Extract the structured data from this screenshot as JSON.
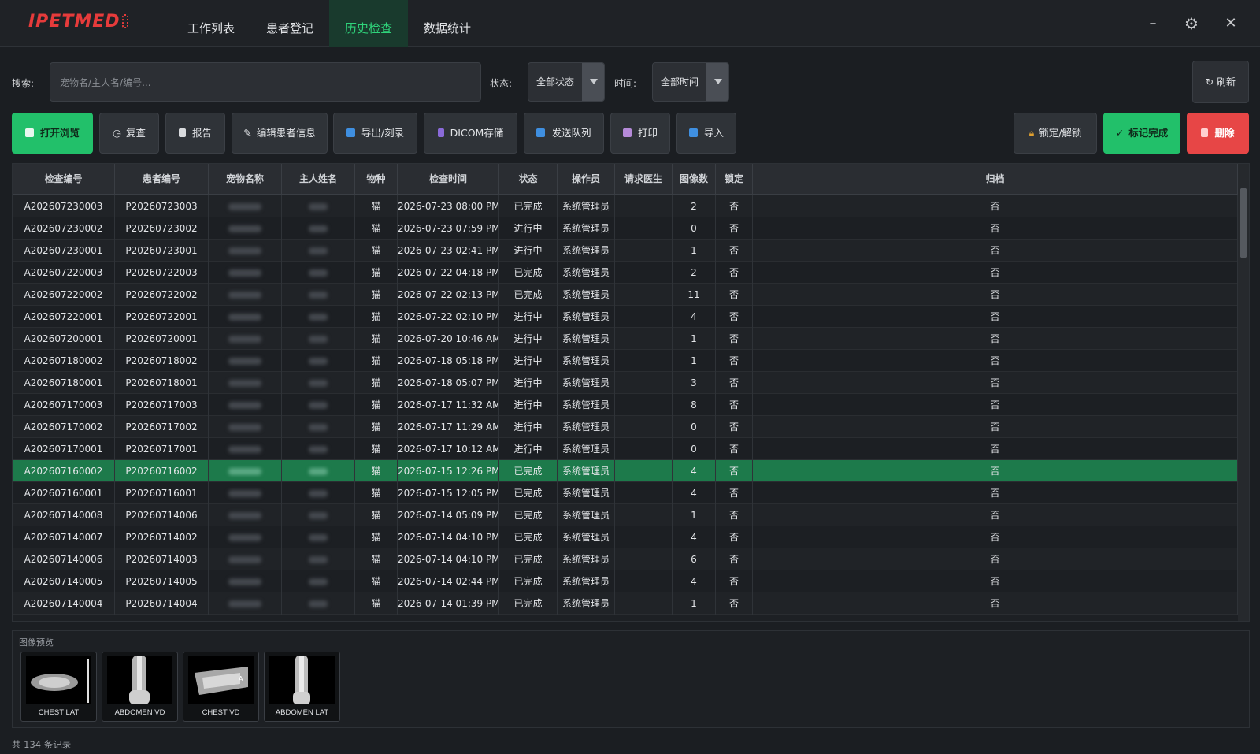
{
  "app": {
    "logo": "IPETMED"
  },
  "nav": [
    {
      "label": "工作列表",
      "active": false
    },
    {
      "label": "患者登记",
      "active": false
    },
    {
      "label": "历史检查",
      "active": true
    },
    {
      "label": "数据统计",
      "active": false
    }
  ],
  "window": {
    "minimize": "–",
    "settings": "⚙",
    "close": "✕"
  },
  "search": {
    "label": "搜索:",
    "placeholder": "宠物名/主人名/编号..."
  },
  "filters": {
    "status_label": "状态:",
    "status_value": "全部状态",
    "time_label": "时间:",
    "time_value": "全部时间"
  },
  "refresh_label": "刷新",
  "toolbar": {
    "open_view": "打开浏览",
    "recheck": "复查",
    "report": "报告",
    "edit_patient": "编辑患者信息",
    "export": "导出/刻录",
    "dicom": "DICOM存储",
    "send_queue": "发送队列",
    "print": "打印",
    "import": "导入",
    "lock": "锁定/解锁",
    "mark_done": "标记完成",
    "delete": "删除"
  },
  "colors": {
    "accent": "#22c06a",
    "danger": "#e74646",
    "selected_row": "#1d7a4b"
  },
  "table": {
    "columns": [
      "检查编号",
      "患者编号",
      "宠物名称",
      "主人姓名",
      "物种",
      "检查时间",
      "状态",
      "操作员",
      "请求医生",
      "图像数",
      "锁定",
      "归档"
    ],
    "rows": [
      {
        "exam": "A202607230003",
        "patient": "P20260723003",
        "species": "猫",
        "time": "2026-07-23 08:00 PM",
        "status": "已完成",
        "operator": "系统管理员",
        "doctor": "",
        "images": "2",
        "locked": "否",
        "archived": "否"
      },
      {
        "exam": "A202607230002",
        "patient": "P20260723002",
        "species": "猫",
        "time": "2026-07-23 07:59 PM",
        "status": "进行中",
        "operator": "系统管理员",
        "doctor": "",
        "images": "0",
        "locked": "否",
        "archived": "否"
      },
      {
        "exam": "A202607230001",
        "patient": "P20260723001",
        "species": "猫",
        "time": "2026-07-23 02:41 PM",
        "status": "进行中",
        "operator": "系统管理员",
        "doctor": "",
        "images": "1",
        "locked": "否",
        "archived": "否"
      },
      {
        "exam": "A202607220003",
        "patient": "P20260722003",
        "species": "猫",
        "time": "2026-07-22 04:18 PM",
        "status": "已完成",
        "operator": "系统管理员",
        "doctor": "",
        "images": "2",
        "locked": "否",
        "archived": "否"
      },
      {
        "exam": "A202607220002",
        "patient": "P20260722002",
        "species": "猫",
        "time": "2026-07-22 02:13 PM",
        "status": "已完成",
        "operator": "系统管理员",
        "doctor": "",
        "images": "11",
        "locked": "否",
        "archived": "否"
      },
      {
        "exam": "A202607220001",
        "patient": "P20260722001",
        "species": "猫",
        "time": "2026-07-22 02:10 PM",
        "status": "进行中",
        "operator": "系统管理员",
        "doctor": "",
        "images": "4",
        "locked": "否",
        "archived": "否"
      },
      {
        "exam": "A202607200001",
        "patient": "P20260720001",
        "species": "猫",
        "time": "2026-07-20 10:46 AM",
        "status": "进行中",
        "operator": "系统管理员",
        "doctor": "",
        "images": "1",
        "locked": "否",
        "archived": "否"
      },
      {
        "exam": "A202607180002",
        "patient": "P20260718002",
        "species": "猫",
        "time": "2026-07-18 05:18 PM",
        "status": "进行中",
        "operator": "系统管理员",
        "doctor": "",
        "images": "1",
        "locked": "否",
        "archived": "否"
      },
      {
        "exam": "A202607180001",
        "patient": "P20260718001",
        "species": "猫",
        "time": "2026-07-18 05:07 PM",
        "status": "进行中",
        "operator": "系统管理员",
        "doctor": "",
        "images": "3",
        "locked": "否",
        "archived": "否"
      },
      {
        "exam": "A202607170003",
        "patient": "P20260717003",
        "species": "猫",
        "time": "2026-07-17 11:32 AM",
        "status": "进行中",
        "operator": "系统管理员",
        "doctor": "",
        "images": "8",
        "locked": "否",
        "archived": "否"
      },
      {
        "exam": "A202607170002",
        "patient": "P20260717002",
        "species": "猫",
        "time": "2026-07-17 11:29 AM",
        "status": "进行中",
        "operator": "系统管理员",
        "doctor": "",
        "images": "0",
        "locked": "否",
        "archived": "否"
      },
      {
        "exam": "A202607170001",
        "patient": "P20260717001",
        "species": "猫",
        "time": "2026-07-17 10:12 AM",
        "status": "进行中",
        "operator": "系统管理员",
        "doctor": "",
        "images": "0",
        "locked": "否",
        "archived": "否"
      },
      {
        "exam": "A202607160002",
        "patient": "P20260716002",
        "species": "猫",
        "time": "2026-07-15 12:26 PM",
        "status": "已完成",
        "operator": "系统管理员",
        "doctor": "",
        "images": "4",
        "locked": "否",
        "archived": "否",
        "selected": true
      },
      {
        "exam": "A202607160001",
        "patient": "P20260716001",
        "species": "猫",
        "time": "2026-07-15 12:05 PM",
        "status": "已完成",
        "operator": "系统管理员",
        "doctor": "",
        "images": "4",
        "locked": "否",
        "archived": "否"
      },
      {
        "exam": "A202607140008",
        "patient": "P20260714006",
        "species": "猫",
        "time": "2026-07-14 05:09 PM",
        "status": "已完成",
        "operator": "系统管理员",
        "doctor": "",
        "images": "1",
        "locked": "否",
        "archived": "否"
      },
      {
        "exam": "A202607140007",
        "patient": "P20260714002",
        "species": "猫",
        "time": "2026-07-14 04:10 PM",
        "status": "已完成",
        "operator": "系统管理员",
        "doctor": "",
        "images": "4",
        "locked": "否",
        "archived": "否"
      },
      {
        "exam": "A202607140006",
        "patient": "P20260714003",
        "species": "猫",
        "time": "2026-07-14 04:10 PM",
        "status": "已完成",
        "operator": "系统管理员",
        "doctor": "",
        "images": "6",
        "locked": "否",
        "archived": "否"
      },
      {
        "exam": "A202607140005",
        "patient": "P20260714005",
        "species": "猫",
        "time": "2026-07-14 02:44 PM",
        "status": "已完成",
        "operator": "系统管理员",
        "doctor": "",
        "images": "4",
        "locked": "否",
        "archived": "否"
      },
      {
        "exam": "A202607140004",
        "patient": "P20260714004",
        "species": "猫",
        "time": "2026-07-14 01:39 PM",
        "status": "已完成",
        "operator": "系统管理员",
        "doctor": "",
        "images": "1",
        "locked": "否",
        "archived": "否"
      }
    ]
  },
  "preview": {
    "title": "图像预览",
    "images": [
      {
        "caption": "CHEST LAT"
      },
      {
        "caption": "ABDOMEN VD"
      },
      {
        "caption": "CHEST VD"
      },
      {
        "caption": "ABDOMEN LAT"
      }
    ]
  },
  "footer": {
    "record_count": "共 134 条记录"
  }
}
